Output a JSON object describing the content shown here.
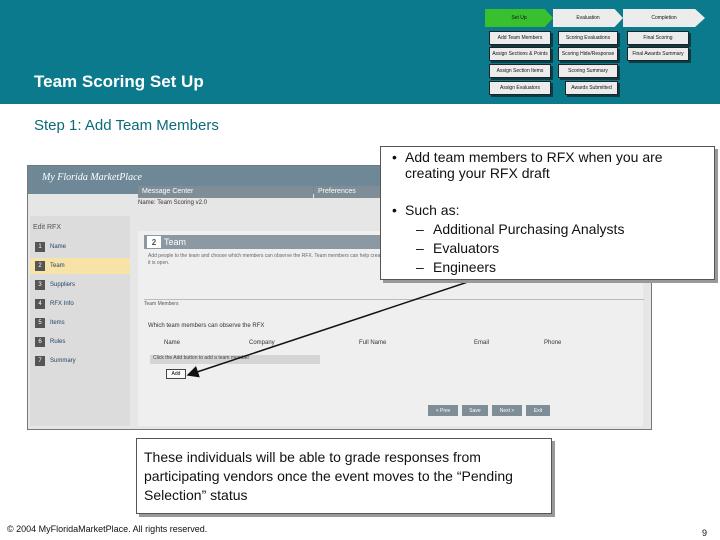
{
  "page": {
    "title": "Team Scoring Set Up",
    "step_heading": "Step 1: Add Team Members",
    "footer": "© 2004 MyFloridaMarketPlace. All rights reserved.",
    "page_number": "9"
  },
  "flow": {
    "steps": [
      {
        "label": "Set Up",
        "color": "#39c02e"
      },
      {
        "label": "Evaluation",
        "color": "#ececec"
      },
      {
        "label": "Completion",
        "color": "#ececec"
      }
    ],
    "setup_boxes": [
      "Add Team Members",
      "Assign Sections & Points",
      "Assign Section Items",
      "Assign Evaluators"
    ],
    "eval_boxes": [
      "Scoring Evaluations",
      "Scoring Hide/Response",
      "Scoring Summary",
      "Awards Submitted"
    ],
    "completion_boxes": [
      "Final Scoring",
      "Final Awards Summary"
    ]
  },
  "screenshot": {
    "logo": "My Florida MarketPlace",
    "tabs": [
      "Message Center",
      "Preferences"
    ],
    "subtitle": "Name: Team Scoring v2.0",
    "sidebar_header": "Edit RFX",
    "sidebar_items": [
      {
        "num": "1",
        "label": "Name"
      },
      {
        "num": "2",
        "label": "Team"
      },
      {
        "num": "3",
        "label": "Suppliers"
      },
      {
        "num": "4",
        "label": "RFX Info"
      },
      {
        "num": "5",
        "label": "Items"
      },
      {
        "num": "6",
        "label": "Rules"
      },
      {
        "num": "7",
        "label": "Summary"
      }
    ],
    "team_num": "2",
    "team_title": "Team",
    "intro_text": "Add people to the team and choose which members can observe the RFX. Team members can help create, edit, and answer questions on the RFX while it is open.",
    "section_label": "Team Members",
    "which_question": "Which team members can observe the RFX",
    "columns": [
      "Name",
      "Company",
      "Full Name",
      "Email",
      "Phone"
    ],
    "hint": "Click the Add button to add a team member",
    "add_button": "Add",
    "nav_buttons": [
      "< Prev",
      "Save",
      "Next >",
      "Exit"
    ]
  },
  "callout_top": {
    "bullet1": "Add team members to RFX when you are creating your RFX draft",
    "bullet2": "Such as:",
    "sub_items": [
      "Additional Purchasing Analysts",
      "Evaluators",
      "Engineers"
    ]
  },
  "callout_bottom": {
    "text": "These individuals will be able to grade responses from participating vendors once the event moves to the “Pending Selection” status"
  }
}
